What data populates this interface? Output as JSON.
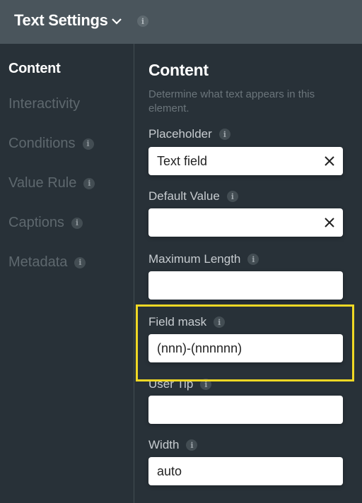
{
  "header": {
    "title": "Text Settings",
    "chevron_icon": "chevron-down-icon",
    "info_icon": "info-icon"
  },
  "sidebar": {
    "items": [
      {
        "label": "Content",
        "active": true,
        "has_info": false
      },
      {
        "label": "Interactivity",
        "active": false,
        "has_info": false
      },
      {
        "label": "Conditions",
        "active": false,
        "has_info": true
      },
      {
        "label": "Value Rule",
        "active": false,
        "has_info": true
      },
      {
        "label": "Captions",
        "active": false,
        "has_info": true
      },
      {
        "label": "Metadata",
        "active": false,
        "has_info": true
      }
    ]
  },
  "main": {
    "title": "Content",
    "description": "Determine what text appears in this element.",
    "fields": [
      {
        "label": "Placeholder",
        "value": "Text field",
        "clearable": true
      },
      {
        "label": "Default Value",
        "value": "",
        "clearable": true
      },
      {
        "label": "Maximum Length",
        "value": "",
        "clearable": false
      },
      {
        "label": "Field mask",
        "value": "(nnn)-(nnnnnn)",
        "clearable": false,
        "highlighted": true
      },
      {
        "label": "User Tip",
        "value": "",
        "clearable": false
      },
      {
        "label": "Width",
        "value": "auto",
        "clearable": false
      }
    ],
    "info_glyph": "i"
  },
  "colors": {
    "header_bg": "#4a555c",
    "panel_bg": "#283138",
    "highlight": "#f0d824"
  }
}
